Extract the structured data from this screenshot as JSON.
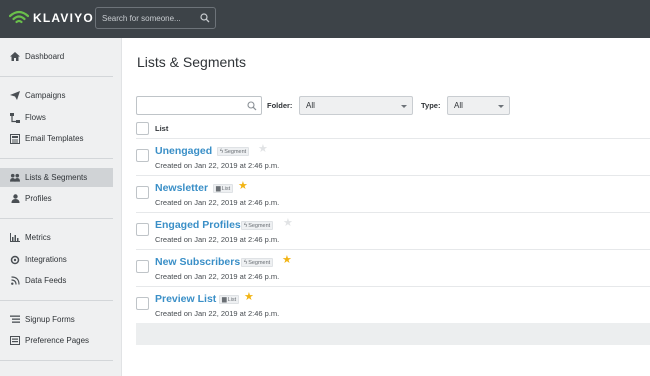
{
  "app": {
    "logo_text": "KLAVIYO"
  },
  "search": {
    "placeholder": "Search for someone..."
  },
  "sidebar": {
    "items": [
      {
        "label": "Dashboard",
        "icon": "home-icon",
        "active": false
      },
      {
        "label": "Campaigns",
        "icon": "paper-plane-icon",
        "active": false
      },
      {
        "label": "Flows",
        "icon": "flow-icon",
        "active": false
      },
      {
        "label": "Email Templates",
        "icon": "template-icon",
        "active": false
      },
      {
        "label": "Lists & Segments",
        "icon": "users-icon",
        "active": true
      },
      {
        "label": "Profiles",
        "icon": "user-icon",
        "active": false
      },
      {
        "label": "Metrics",
        "icon": "bar-chart-icon",
        "active": false
      },
      {
        "label": "Integrations",
        "icon": "integrations-icon",
        "active": false
      },
      {
        "label": "Data Feeds",
        "icon": "rss-icon",
        "active": false
      },
      {
        "label": "Signup Forms",
        "icon": "form-icon",
        "active": false
      },
      {
        "label": "Preference Pages",
        "icon": "preferences-icon",
        "active": false
      }
    ]
  },
  "main": {
    "title": "Lists & Segments",
    "filter": {
      "search_value": "",
      "folder_label": "Folder:",
      "folder_value": "All",
      "type_label": "Type:",
      "type_value": "All"
    },
    "column_header": "List",
    "rows": [
      {
        "name": "Unengaged",
        "kind": "Segment",
        "starred": false,
        "created": "Created on Jan 22, 2019 at 2:46 p.m."
      },
      {
        "name": "Newsletter",
        "kind": "List",
        "starred": true,
        "created": "Created on Jan 22, 2019 at 2:46 p.m."
      },
      {
        "name": "Engaged Profiles",
        "kind": "Segment",
        "starred": false,
        "created": "Created on Jan 22, 2019 at 2:46 p.m."
      },
      {
        "name": "New Subscribers",
        "kind": "Segment",
        "starred": true,
        "created": "Created on Jan 22, 2019 at 2:46 p.m."
      },
      {
        "name": "Preview List",
        "kind": "List",
        "starred": true,
        "created": "Created on Jan 22, 2019 at 2:46 p.m."
      }
    ]
  },
  "colors": {
    "topbar": "#3d4348",
    "link": "#3a8fc7",
    "star": "#f2b413",
    "sidebar": "#eff0f1",
    "logo_green": "#6abf4b"
  }
}
